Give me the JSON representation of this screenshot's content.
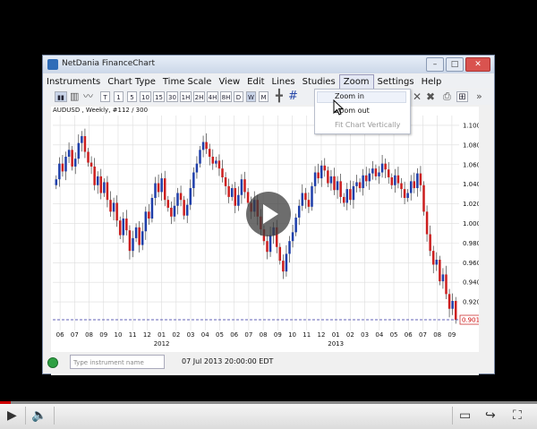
{
  "window": {
    "title": "NetDania FinanceChart",
    "controls": [
      "–",
      "□",
      "✕"
    ]
  },
  "menu": [
    "Instruments",
    "Chart Type",
    "Time Scale",
    "View",
    "Edit",
    "Lines",
    "Studies",
    "Zoom",
    "Settings",
    "Help"
  ],
  "menu_active": "Zoom",
  "toolbar": {
    "buttons": [
      "T",
      "1",
      "5",
      "10",
      "15",
      "30",
      "1H",
      "2H",
      "4H",
      "8H",
      "D",
      "W",
      "M"
    ],
    "selected": "W",
    "icons": [
      "candlestick-icon",
      "bar-chart-icon",
      "line-chart-icon",
      "crosshair-icon",
      "hash-icon",
      "close-icon",
      "cross-icon",
      "print-icon",
      "save-icon",
      "more-icon"
    ]
  },
  "zoom_menu": {
    "items": [
      {
        "label": "Zoom in",
        "enabled": true
      },
      {
        "label": "Zoom out",
        "enabled": true
      },
      {
        "label": "Fit Chart Vertically",
        "enabled": false
      }
    ]
  },
  "chart_data": {
    "type": "candlestick",
    "label": "AUDUSD , Weekly, #112 / 300",
    "y_ticks": [
      "1.1000",
      "1.0800",
      "1.0600",
      "1.0400",
      "1.0200",
      "1.0000",
      "0.9800",
      "0.9600",
      "0.9400",
      "0.9200"
    ],
    "y_tick_values": [
      1.1,
      1.08,
      1.06,
      1.04,
      1.02,
      1.0,
      0.98,
      0.96,
      0.94,
      0.92
    ],
    "ylim": [
      0.9,
      1.11
    ],
    "x_ticks": [
      "06",
      "07",
      "08",
      "09",
      "10",
      "11",
      "12",
      "01",
      "02",
      "03",
      "04",
      "05",
      "06",
      "07",
      "08",
      "09",
      "10",
      "11",
      "12",
      "01",
      "02",
      "03",
      "04",
      "05",
      "06",
      "07",
      "08",
      "09"
    ],
    "year_labels": [
      {
        "label": "2012",
        "after_tick": 7
      },
      {
        "label": "2013",
        "after_tick": 19
      }
    ],
    "last_price": "0.9018",
    "last_price_value": 0.9018,
    "colors": {
      "up": "#1f3faa",
      "down": "#cc1f1f",
      "last": "#3030a0",
      "grid": "#dddddd"
    },
    "closes": [
      1.045,
      1.061,
      1.053,
      1.068,
      1.075,
      1.058,
      1.066,
      1.082,
      1.089,
      1.073,
      1.062,
      1.058,
      1.039,
      1.048,
      1.031,
      1.042,
      1.024,
      1.012,
      1.021,
      1.003,
      0.988,
      1.005,
      0.993,
      0.972,
      0.985,
      0.996,
      0.978,
      0.992,
      1.012,
      1.005,
      1.026,
      1.041,
      1.032,
      1.046,
      1.024,
      1.016,
      1.007,
      1.018,
      1.031,
      1.024,
      1.008,
      1.019,
      1.036,
      1.052,
      1.061,
      1.075,
      1.083,
      1.076,
      1.068,
      1.061,
      1.064,
      1.056,
      1.047,
      1.038,
      1.027,
      1.036,
      1.018,
      1.029,
      1.045,
      1.032,
      1.021,
      1.012,
      1.024,
      1.007,
      0.994,
      0.982,
      0.971,
      0.988,
      0.996,
      0.976,
      0.962,
      0.951,
      0.969,
      0.982,
      0.991,
      1.006,
      1.018,
      1.031,
      1.024,
      1.017,
      1.038,
      1.052,
      1.046,
      1.059,
      1.054,
      1.041,
      1.048,
      1.034,
      1.043,
      1.027,
      1.021,
      1.035,
      1.024,
      1.038,
      1.042,
      1.036,
      1.049,
      1.043,
      1.051,
      1.056,
      1.048,
      1.052,
      1.061,
      1.055,
      1.047,
      1.039,
      1.049,
      1.041,
      1.035,
      1.026,
      1.031,
      1.043,
      1.036,
      1.051,
      1.039,
      1.012,
      0.989,
      0.972,
      0.958,
      0.963,
      0.941,
      0.948,
      0.928,
      0.913,
      0.921,
      0.9018
    ]
  },
  "status": {
    "instrument_placeholder": "Type instrument name",
    "timestamp": "07 Jul 2013 20:00:00 EDT"
  },
  "player": {
    "progress": 0.02,
    "icons": [
      "play-icon",
      "volume-icon",
      "subtitles-icon",
      "share-icon",
      "fullscreen-icon"
    ]
  }
}
